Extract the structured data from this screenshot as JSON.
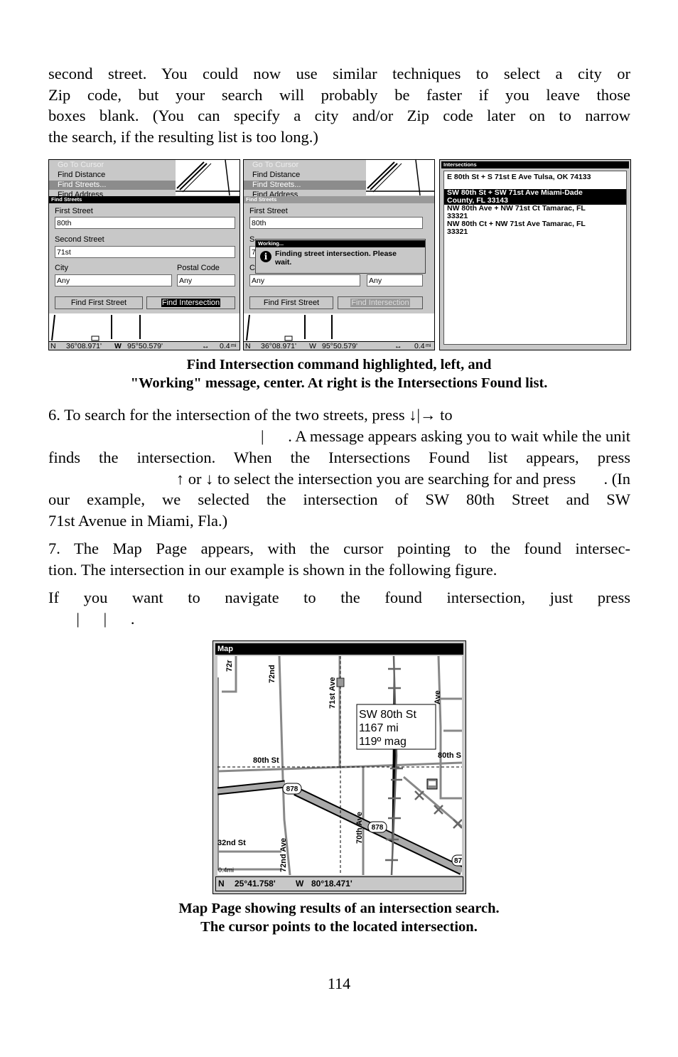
{
  "intro_lines": [
    "second street. You could now use similar techniques to select a city or",
    "Zip code, but your search will probably be faster if you leave those",
    "boxes blank. (You can specify a city and/or Zip code later on to narrow",
    "the search, if the resulting list is too long.)"
  ],
  "figure1": {
    "menu": {
      "items": [
        "Go To Cursor",
        "Find Distance",
        "Find Streets...",
        "Find Address"
      ]
    },
    "dialog_title": "Find Streets",
    "first_street_label": "First Street",
    "first_street_value": "80th",
    "second_street_label": "Second Street",
    "second_street_value": "71st",
    "city_label": "City",
    "city_value": "Any",
    "postal_label": "Postal Code",
    "postal_value": "Any",
    "find_first_street": "Find First Street",
    "find_intersection": "Find Intersection",
    "status": {
      "ns": "N",
      "lat": "36°08.971'",
      "ew": "W",
      "lon": "95°50.579'",
      "zoom_icon": "↔",
      "zoom": "0.4",
      "unit": "mi"
    },
    "working": {
      "title": "Working...",
      "message_line1": "Finding street intersection.  Please",
      "message_line2": "wait.",
      "icon": "info-icon",
      "partial_label": "S",
      "partial_field": "7",
      "partial_city": "C"
    },
    "intersections": {
      "title": "Intersections",
      "items": [
        {
          "lines": [
            "E 80th St + S 71st E Ave Tulsa, OK  74133"
          ],
          "selected": false
        },
        {
          "lines": [
            "SW 80th St + SW 71st Ave Miami-Dade",
            "County, FL  33143"
          ],
          "selected": true
        },
        {
          "lines": [
            "NW 80th Ave + NW 71st Ct Tamarac, FL",
            "33321"
          ],
          "selected": false
        },
        {
          "lines": [
            "NW 80th Ct + NW 71st Ave Tamarac, FL",
            "33321"
          ],
          "selected": false
        }
      ]
    },
    "caption_lines": [
      "Find Intersection command highlighted, left, and",
      "\"Working\" message, center. At right is the Intersections Found list."
    ]
  },
  "step6_lines": [
    "6. To search for the intersection of the two streets, press ↓|→ to",
    "              |      . A message appears asking you to wait while the unit",
    "finds the intersection. When the Intersections Found list appears, press",
    "↑ or ↓ to select the intersection you are searching for and press       . (In",
    "our example, we selected the intersection of SW 80th Street and SW",
    "71st Avenue in Miami, Fla.)"
  ],
  "step7_lines": [
    "7. The Map Page appears, with the cursor pointing to the found intersec-",
    "tion. The intersection in our example is shown in the following figure."
  ],
  "navigate_lines": [
    "If you want to navigate to the found intersection, just press",
    "       |      |      ."
  ],
  "figure2": {
    "title": "Map",
    "labels": {
      "s72r": "72r",
      "s72nd": "72nd",
      "ave71": "71st Ave",
      "ave_r": "Ave",
      "st80": "80th St",
      "st80r": "80th S",
      "hw1": "878",
      "hw2": "878",
      "hw3": "87",
      "ave70": "70th Ave",
      "st82": "32nd St",
      "ave72": "72nd Ave",
      "scale": "0.4mi"
    },
    "popup": [
      "SW 80th St",
      "1167 mi",
      "119º mag"
    ],
    "status": {
      "ns": "N",
      "lat": "25°41.758'",
      "ew": "W",
      "lon": "80°18.471'"
    },
    "caption_lines": [
      "Map Page showing results of an intersection search.",
      "The cursor points to the located intersection."
    ]
  },
  "page_number": "114"
}
